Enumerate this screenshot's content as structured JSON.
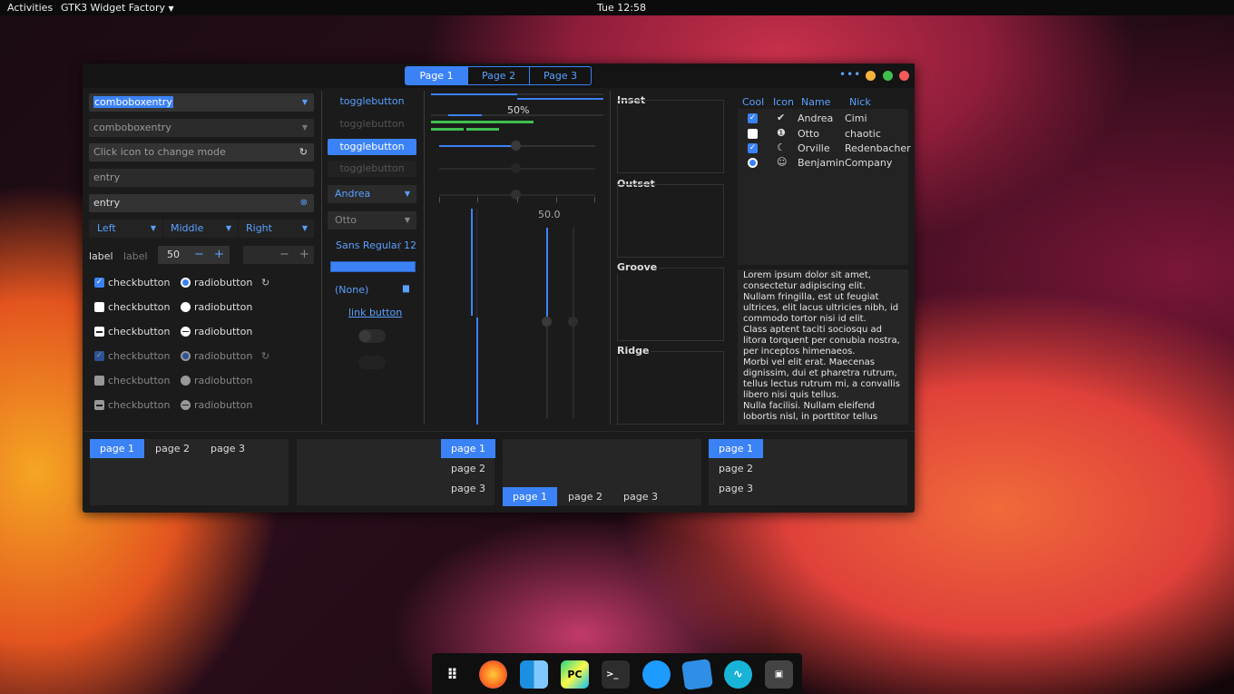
{
  "topbar": {
    "activities": "Activities",
    "app_name": "GTK3 Widget Factory",
    "clock": "Tue 12:58"
  },
  "header": {
    "tabs": [
      "Page 1",
      "Page 2",
      "Page 3"
    ],
    "menu_dots": "•••"
  },
  "col1": {
    "combo1": "comboboxentry",
    "combo2": "comboboxentry",
    "icon_entry_placeholder": "Click icon to change mode",
    "entry1_placeholder": "entry",
    "entry2_value": "entry",
    "align": [
      "Left",
      "Middle",
      "Right"
    ],
    "label1": "label",
    "label2": "label",
    "spin_value": "50",
    "spin_minus": "−",
    "spin_plus": "+",
    "check_label": "checkbutton",
    "radio_label": "radiobutton"
  },
  "col2": {
    "toggles": [
      "togglebutton",
      "togglebutton",
      "togglebutton",
      "togglebutton"
    ],
    "combo_andrea": "Andrea",
    "combo_otto": "Otto",
    "font_name": "Sans Regular",
    "font_size": "12",
    "file_none": "(None)",
    "link": "link button"
  },
  "col3": {
    "progress_label": "50%",
    "scale_value": "50.0",
    "progress_value": 0.5
  },
  "frames": [
    "Inset",
    "Outset",
    "Groove",
    "Ridge"
  ],
  "tree": {
    "headers": [
      "Cool",
      "Icon",
      "Name",
      "Nick"
    ],
    "rows": [
      {
        "name": "Andrea",
        "nick": "Cimi"
      },
      {
        "name": "Otto",
        "nick": "chaotic"
      },
      {
        "name": "Orville",
        "nick": "Redenbacher"
      },
      {
        "name": "Benjamin",
        "nick": "Company"
      }
    ]
  },
  "textview": [
    "Lorem ipsum dolor sit amet,",
    "consectetur adipiscing elit.",
    "Nullam fringilla, est ut feugiat",
    "ultrices, elit lacus ultricies nibh, id",
    "commodo tortor nisi id elit.",
    "Class aptent taciti sociosqu ad",
    "litora torquent per conubia nostra,",
    "per inceptos himenaeos.",
    "Morbi vel elit erat. Maecenas",
    "dignissim, dui et pharetra rutrum,",
    "tellus lectus rutrum mi, a convallis",
    "libero nisi quis tellus.",
    "Nulla facilisi. Nullam eleifend",
    "lobortis nisl, in porttitor tellus"
  ],
  "notebook_pages": [
    "page 1",
    "page 2",
    "page 3"
  ],
  "colors": {
    "accent": "#3b82f6",
    "green": "#3fbf4f",
    "close": "#f05a5a",
    "min": "#f5b33a",
    "max": "#3fbf4f"
  },
  "dock": [
    "apps-grid-icon",
    "firefox-icon",
    "finder-icon",
    "pycharm-icon",
    "terminal-icon",
    "clock-icon",
    "mail-icon",
    "audio-icon",
    "screen-icon"
  ]
}
